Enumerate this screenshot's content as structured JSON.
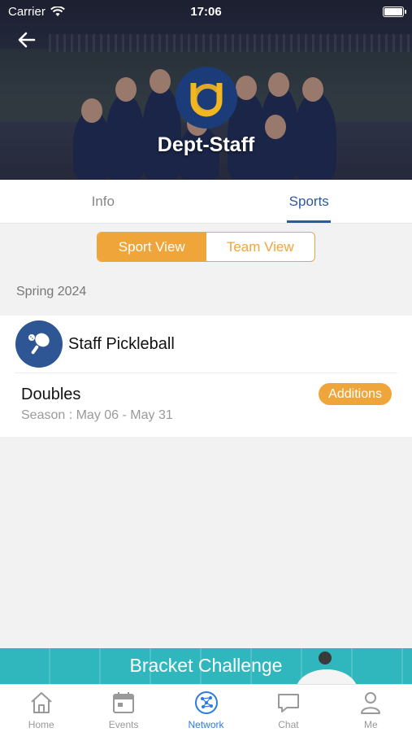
{
  "status_bar": {
    "carrier": "Carrier",
    "time": "17:06"
  },
  "header": {
    "team_name": "Dept-Staff"
  },
  "tabs": [
    {
      "label": "Info"
    },
    {
      "label": "Sports"
    }
  ],
  "view_toggle": {
    "options": [
      "Sport View",
      "Team View"
    ],
    "selected": "Sport View"
  },
  "season_label": "Spring 2024",
  "sport": {
    "name": "Staff Pickleball",
    "icon": "pickleball-icon",
    "league": {
      "name": "Doubles",
      "dates": "Season : May 06 - May 31",
      "badge": "Additions"
    }
  },
  "banner": {
    "text": "Bracket Challenge"
  },
  "bottom_nav": [
    {
      "label": "Home",
      "icon": "home-icon"
    },
    {
      "label": "Events",
      "icon": "calendar-icon"
    },
    {
      "label": "Network",
      "icon": "network-icon"
    },
    {
      "label": "Chat",
      "icon": "chat-icon"
    },
    {
      "label": "Me",
      "icon": "user-icon"
    }
  ],
  "colors": {
    "accent": "#f0a53a",
    "primary": "#2c5a9e",
    "nav_active": "#2c7be0",
    "banner": "#2fb7bd"
  }
}
